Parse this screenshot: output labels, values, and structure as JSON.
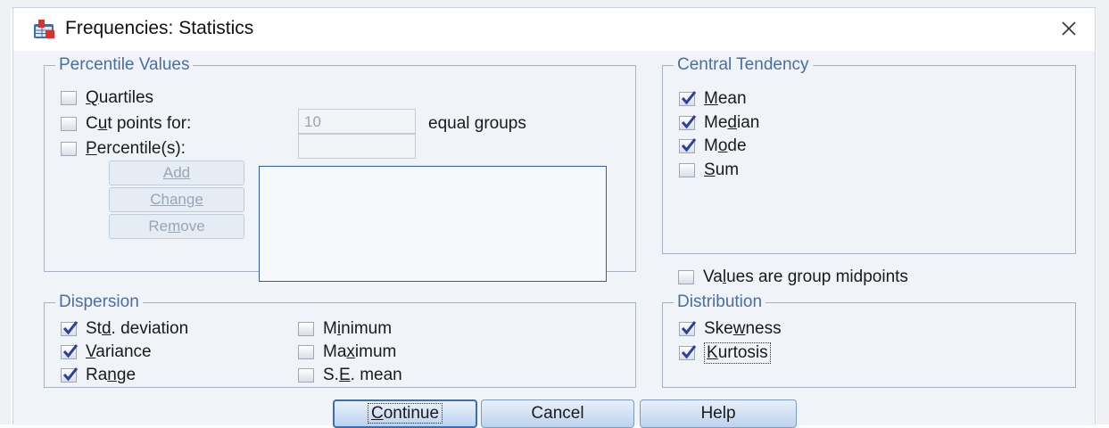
{
  "window": {
    "title": "Frequencies: Statistics"
  },
  "percentile_values": {
    "legend": "Percentile Values",
    "quartiles": {
      "label": "Quartiles",
      "mnemonic": "Q",
      "checked": false
    },
    "cut_points": {
      "label_pre": "C",
      "mnemonic": "u",
      "label_post": "t points for:",
      "value": "10",
      "suffix": "equal groups",
      "checked": false
    },
    "percentiles": {
      "label": "Percentile(s):",
      "mnemonic": "P",
      "value": "",
      "checked": false
    },
    "add_button": "Add",
    "change_button": "Change",
    "remove_button": {
      "pre": "Re",
      "mnemonic": "m",
      "post": "ove"
    }
  },
  "central_tendency": {
    "legend": "Central Tendency",
    "items": [
      {
        "pre": "",
        "mnemonic": "M",
        "post": "ean",
        "checked": true
      },
      {
        "pre": "Me",
        "mnemonic": "d",
        "post": "ian",
        "checked": true
      },
      {
        "pre": "M",
        "mnemonic": "o",
        "post": "de",
        "checked": true
      },
      {
        "pre": "",
        "mnemonic": "S",
        "post": "um",
        "checked": false
      }
    ]
  },
  "group_midpoints": {
    "pre": "Va",
    "mnemonic": "l",
    "post": "ues are group midpoints",
    "checked": false
  },
  "dispersion": {
    "legend": "Dispersion",
    "std_dev": {
      "pre": "St",
      "mnemonic": "d",
      "post": ". deviation",
      "checked": true
    },
    "variance": {
      "pre": "",
      "mnemonic": "V",
      "post": "ariance",
      "checked": true
    },
    "range": {
      "pre": "Ra",
      "mnemonic": "n",
      "post": "ge",
      "checked": true
    },
    "minimum": {
      "pre": "M",
      "mnemonic": "i",
      "post": "nimum",
      "checked": false
    },
    "maximum": {
      "pre": "Ma",
      "mnemonic": "x",
      "post": "imum",
      "checked": false
    },
    "se_mean": {
      "pre": "S.",
      "mnemonic": "E",
      "post": ". mean",
      "checked": false
    }
  },
  "distribution": {
    "legend": "Distribution",
    "skewness": {
      "pre": "Ske",
      "mnemonic": "w",
      "post": "ness",
      "checked": true
    },
    "kurtosis": {
      "pre": "",
      "mnemonic": "K",
      "post": "urtosis",
      "checked": true
    }
  },
  "buttons": {
    "continue": {
      "pre": "",
      "mnemonic": "C",
      "post": "ontinue"
    },
    "cancel": "Cancel",
    "help": "Help"
  },
  "colors": {
    "legend_text": "#4a6ea0",
    "check_mark": "#2b3f9c",
    "client_bg": "#f0f3f7"
  },
  "icons": {
    "app": "spss-table-icon",
    "close": "close-icon",
    "check": "check-icon"
  }
}
